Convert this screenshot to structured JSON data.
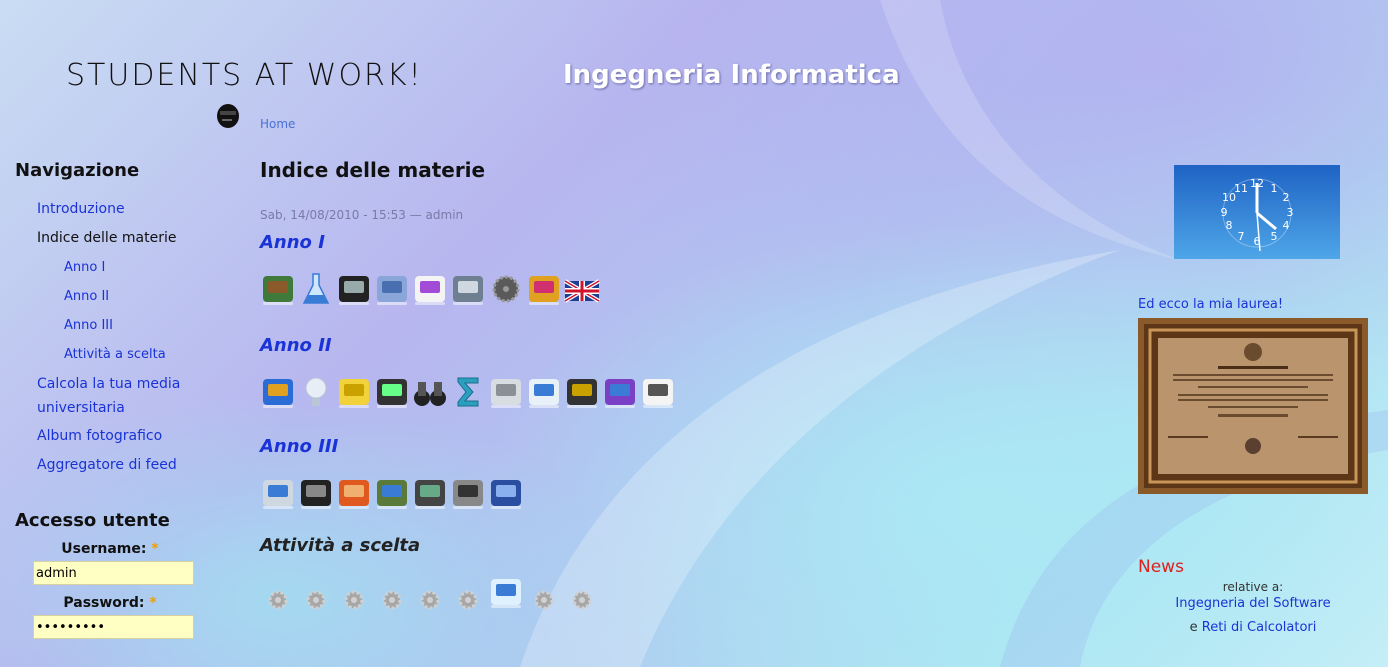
{
  "header": {
    "logo_text": "STUDENTS AT WORK!",
    "site_title": "Ingegneria Informatica",
    "breadcrumb": "Home"
  },
  "sidebar": {
    "nav_title": "Navigazione",
    "items": [
      {
        "label": "Introduzione",
        "level": 1,
        "active": false
      },
      {
        "label": "Indice delle materie",
        "level": 1,
        "active": true
      },
      {
        "label": "Anno I",
        "level": 2
      },
      {
        "label": "Anno II",
        "level": 2
      },
      {
        "label": "Anno III",
        "level": 2
      },
      {
        "label": "Attività a scelta",
        "level": 2
      },
      {
        "label": "Calcola la tua media universitaria",
        "level": 1
      },
      {
        "label": "Album fotografico",
        "level": 1
      },
      {
        "label": "Aggregatore di feed",
        "level": 1
      }
    ],
    "login_title": "Accesso utente",
    "username_label": "Username:",
    "username_value": "admin",
    "password_label": "Password:",
    "password_value": "•••••••••",
    "required_mark": "*"
  },
  "main": {
    "page_title": "Indice delle materie",
    "submitted": "Sab, 14/08/2010 - 15:53 — admin",
    "sections": [
      {
        "title": "Anno I",
        "icons": [
          "chalkboard-icon",
          "flask-icon",
          "terminal-icon",
          "geometry-icon",
          "bezier-curve-icon",
          "image-edit-icon",
          "gear-icon",
          "toy-blocks-icon",
          "uk-flag-icon"
        ]
      },
      {
        "title": "Anno II",
        "icons": [
          "chart-icon",
          "lightbulb-icon",
          "battery-icon",
          "oscilloscope-icon",
          "binoculars-icon",
          "sigma-icon",
          "database-icon",
          "settings-list-icon",
          "chip-icon",
          "cpp-icon",
          "c-file-icon"
        ]
      },
      {
        "title": "Anno III",
        "icons": [
          "network-computer-icon",
          "circuit-icon",
          "java-icon",
          "robot-icon",
          "laptop-icon",
          "fingerprint-icon",
          "grid-cube-icon"
        ]
      },
      {
        "title": "Attività a scelta",
        "icons": [
          "gear-small-icon",
          "gear-small-icon",
          "gear-small-icon",
          "gear-small-icon",
          "gear-small-icon",
          "gear-small-icon",
          "document-icon",
          "gear-small-icon",
          "gear-small-icon"
        ]
      }
    ]
  },
  "right": {
    "laurea_text": "Ed ecco la mia laurea!",
    "news_title": "News",
    "news_cut": "relative a:",
    "news_link1": "Ingegneria del Software",
    "news_prefix": "e ",
    "news_link2": "Reti di Calcolatori"
  },
  "colors": {
    "link": "#1a33d6",
    "news_title": "#e0201c",
    "input_bg": "#ffffc4",
    "required": "#f0a000"
  }
}
